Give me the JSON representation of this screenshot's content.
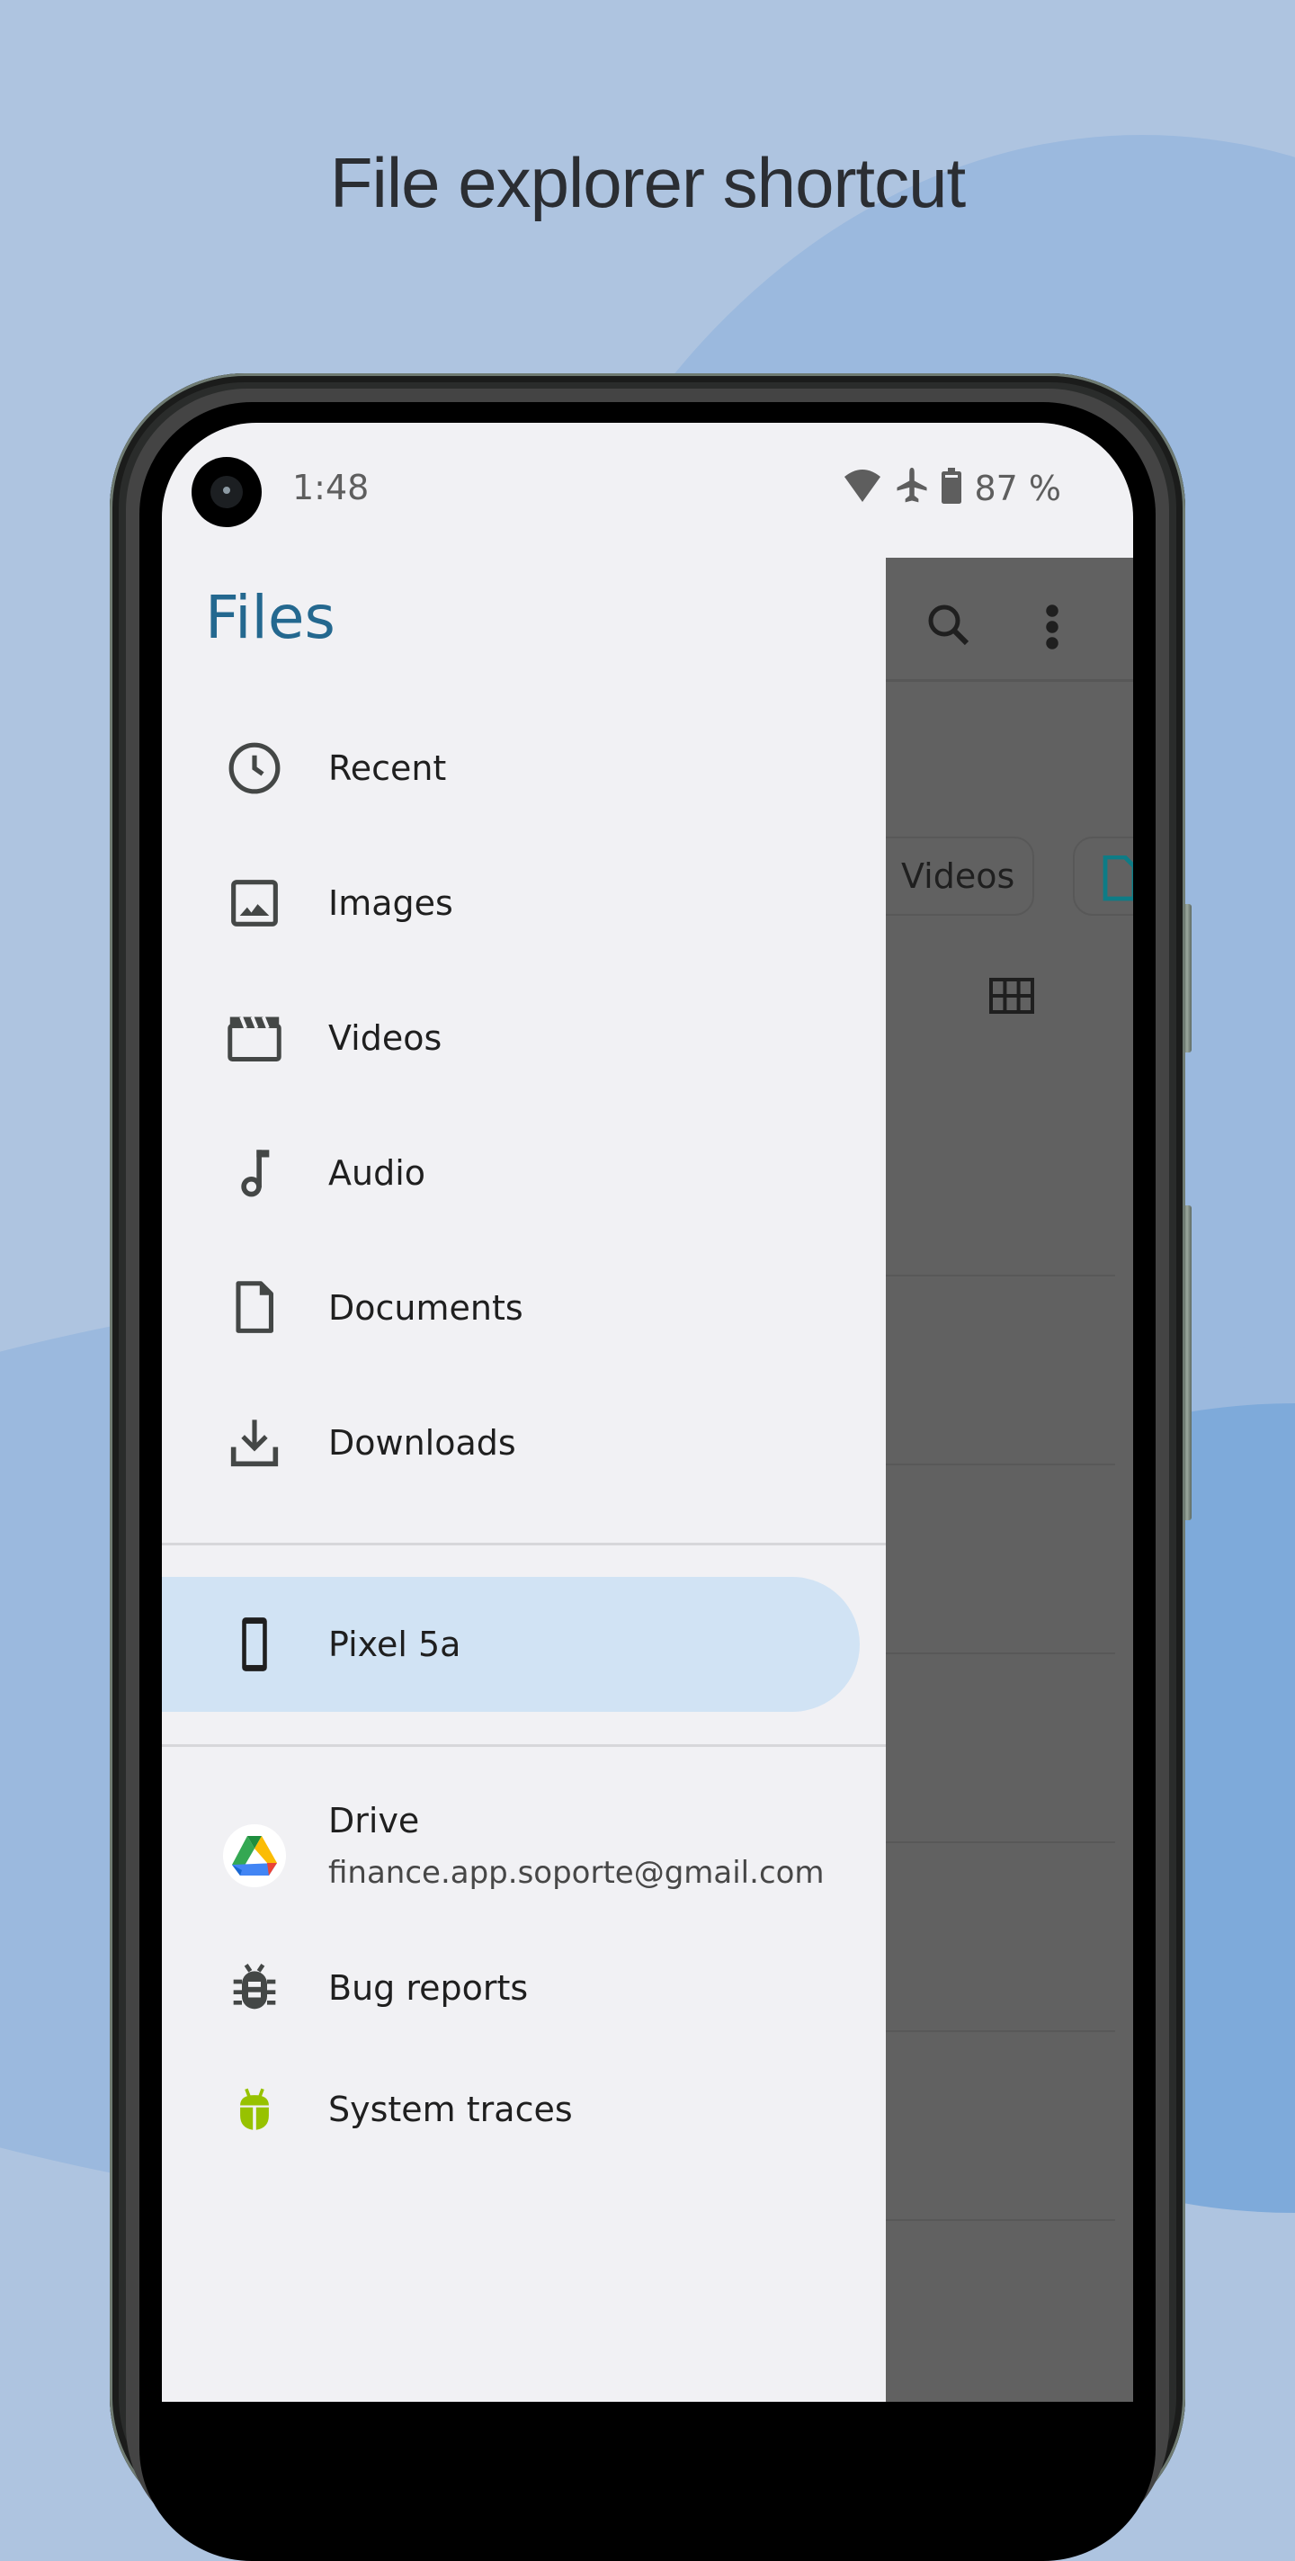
{
  "headline": "File explorer shortcut",
  "colors": {
    "background": "#aec4e0",
    "accent_title": "#24688f",
    "drawer_bg": "#f1f1f4",
    "selected_bg": "#d1e3f4",
    "scrim": "#616161",
    "android_green": "#97c200"
  },
  "status_bar": {
    "time": "1:48",
    "icons": [
      "wifi-icon",
      "airplane-icon",
      "battery-icon"
    ],
    "battery_percent": "87 %"
  },
  "drawer": {
    "title": "Files",
    "categories": [
      {
        "label": "Recent",
        "icon": "clock-icon"
      },
      {
        "label": "Images",
        "icon": "image-icon"
      },
      {
        "label": "Videos",
        "icon": "clapperboard-icon"
      },
      {
        "label": "Audio",
        "icon": "music-note-icon"
      },
      {
        "label": "Documents",
        "icon": "document-icon"
      },
      {
        "label": "Downloads",
        "icon": "download-icon"
      }
    ],
    "device": {
      "label": "Pixel 5a",
      "icon": "phone-icon",
      "selected": true
    },
    "drive": {
      "label": "Drive",
      "account": "finance.app.soporte@gmail.com",
      "icon": "google-drive-icon"
    },
    "tools": [
      {
        "label": "Bug reports",
        "icon": "bug-icon"
      },
      {
        "label": "System traces",
        "icon": "android-bug-icon"
      }
    ]
  },
  "background_app": {
    "toolbar_icons": [
      "search-icon",
      "more-vert-icon"
    ],
    "chips": [
      "Videos"
    ],
    "view_toggle_icon": "grid-view-icon"
  }
}
